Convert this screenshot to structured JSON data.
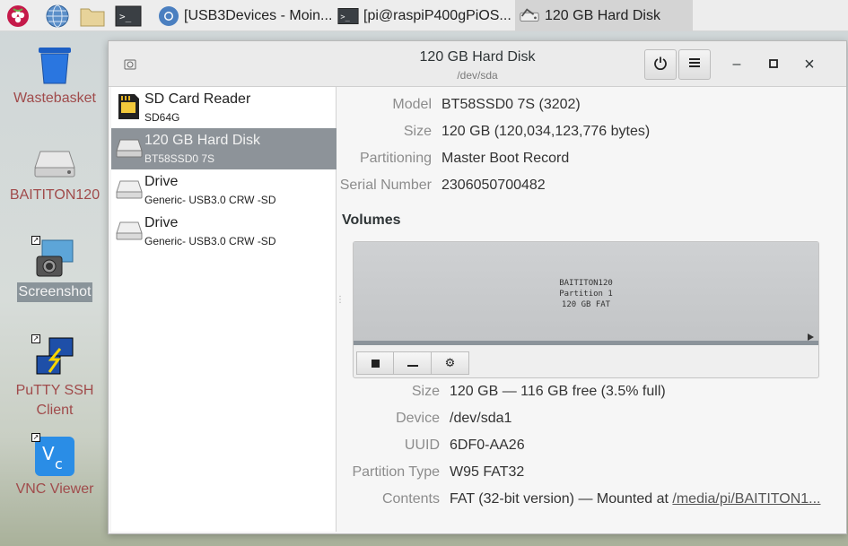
{
  "taskbar": {
    "launchers": [
      {
        "icon": "raspberry-menu-icon"
      },
      {
        "icon": "globe-browser-icon"
      },
      {
        "icon": "folder-icon"
      },
      {
        "icon": "terminal-icon"
      }
    ],
    "tasks": [
      {
        "label": "[USB3Devices - Moin...",
        "icon": "chromium-icon"
      },
      {
        "label": "[pi@raspiP400gPiOS...",
        "icon": "terminal-icon"
      },
      {
        "label": "120 GB Hard Disk",
        "icon": "disks-icon"
      }
    ]
  },
  "desktop": {
    "icons": [
      {
        "label": "Wastebasket",
        "icon": "wastebasket-icon"
      },
      {
        "label": "BAITITON120",
        "icon": "drive-icon"
      },
      {
        "label": "Screenshot",
        "icon": "screenshot-camera-icon"
      },
      {
        "label": "PuTTY SSH\nClient",
        "label_line1": "PuTTY SSH",
        "label_line2": "Client",
        "icon": "putty-icon"
      },
      {
        "label": "VNC Viewer",
        "icon": "vnc-icon"
      }
    ]
  },
  "window": {
    "title": "120 GB Hard Disk",
    "subtitle": "/dev/sda",
    "power_icon": "power-icon",
    "menu_icon": "menu-icon",
    "minimize": "–",
    "maximize": "□",
    "close": "×"
  },
  "sidebar": {
    "devices": [
      {
        "name": "SD Card Reader",
        "desc": "SD64G",
        "icon": "sd-card-icon",
        "selected": false
      },
      {
        "name": "120 GB Hard Disk",
        "desc": "BT58SSD0 7S",
        "icon": "hard-disk-icon",
        "selected": true
      },
      {
        "name": "Drive",
        "desc": "Generic- USB3.0 CRW   -SD",
        "icon": "drive-icon",
        "selected": false
      },
      {
        "name": "Drive",
        "desc": "Generic- USB3.0 CRW   -SD",
        "icon": "drive-icon",
        "selected": false
      }
    ]
  },
  "disk": {
    "model_label": "Model",
    "model": "BT58SSD0 7S (3202)",
    "size_label": "Size",
    "size": "120 GB (120,034,123,776 bytes)",
    "partitioning_label": "Partitioning",
    "partitioning": "Master Boot Record",
    "serial_label": "Serial Number",
    "serial": "2306050700482"
  },
  "volumes": {
    "heading": "Volumes",
    "partition_name": "BAITITON120",
    "partition_num": "Partition 1",
    "partition_desc": "120 GB FAT",
    "tools": [
      "■",
      "–",
      "⚙"
    ]
  },
  "partition": {
    "size_label": "Size",
    "size": "120 GB — 116 GB free (3.5% full)",
    "device_label": "Device",
    "device": "/dev/sda1",
    "uuid_label": "UUID",
    "uuid": "6DF0-AA26",
    "type_label": "Partition Type",
    "type": "W95 FAT32",
    "contents_label": "Contents",
    "contents": "FAT (32-bit version) — Mounted at ",
    "mount_link": "/media/pi/BAITITON1..."
  }
}
